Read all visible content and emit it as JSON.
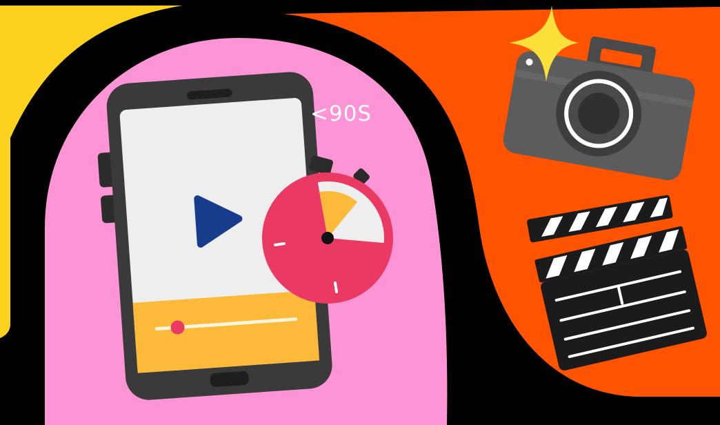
{
  "illustration": {
    "duration_label": "<90S",
    "timer_fraction_elapsed": 0.25,
    "video_progress": 0.15
  },
  "palette": {
    "background": "#000000",
    "left_accent": "#fcd21f",
    "pink_blob": "#fd94d5",
    "orange_blob": "#fe5300",
    "phone_body": "#3a3a3a",
    "phone_screen": "#eeeeef",
    "play_button": "#173c8b",
    "player_bar": "#fdb93a",
    "scrubber_handle": "#eb3a62",
    "stopwatch_red": "#ea3a63",
    "stopwatch_yellow": "#fcb93a",
    "camera_body": "#5c5c5c",
    "camera_lens": "#303030",
    "sparkle": "#fce03a",
    "clapper": "#1b1b1b"
  },
  "icons": [
    "smartphone-icon",
    "play-icon",
    "stopwatch-icon",
    "camera-icon",
    "sparkle-icon",
    "clapperboard-icon"
  ]
}
